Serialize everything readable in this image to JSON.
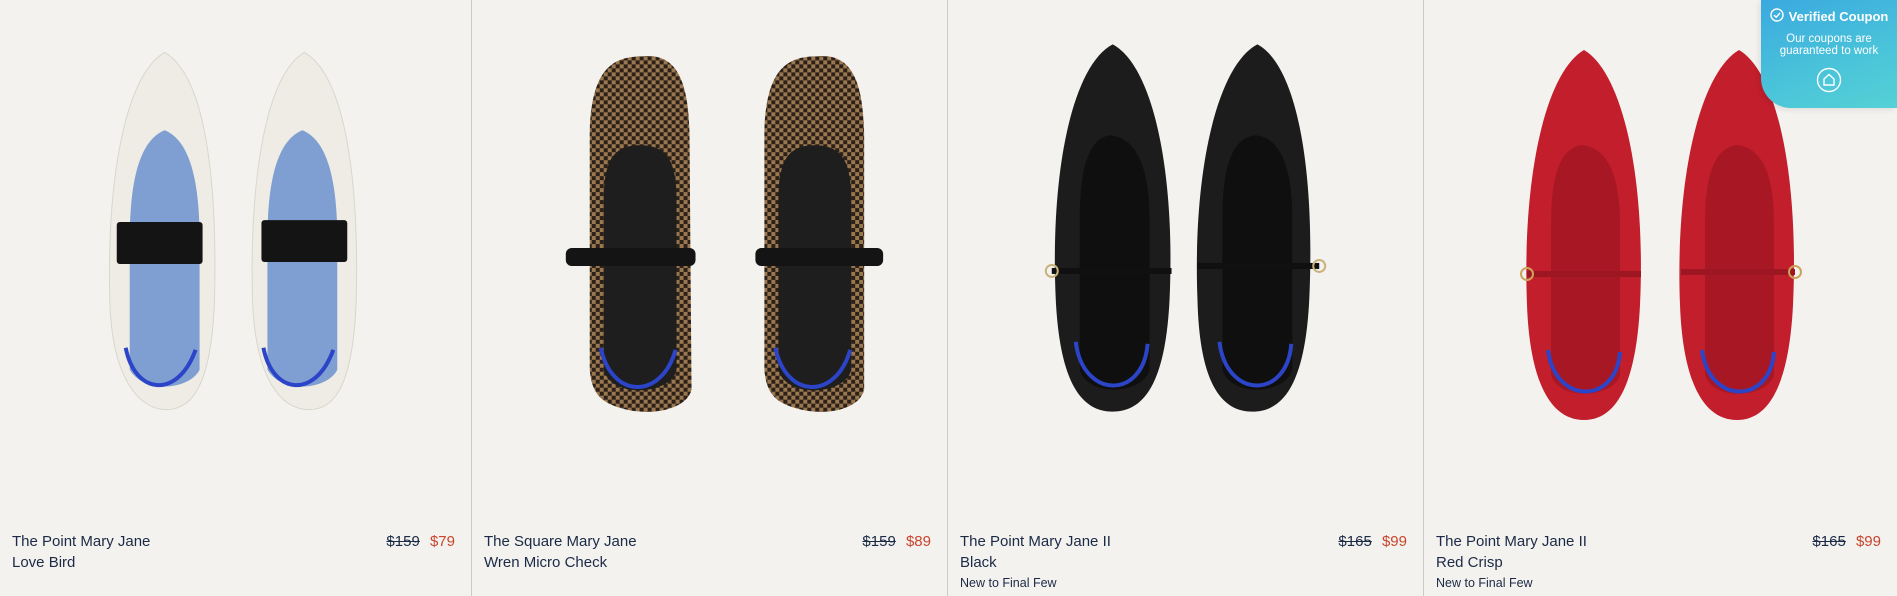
{
  "products": [
    {
      "name": "The Point Mary Jane",
      "variant": "Love Bird",
      "old_price": "$159",
      "price": "$79",
      "tag": ""
    },
    {
      "name": "The Square Mary Jane",
      "variant": "Wren Micro Check",
      "old_price": "$159",
      "price": "$89",
      "tag": ""
    },
    {
      "name": "The Point Mary Jane II",
      "variant": "Black",
      "old_price": "$165",
      "price": "$99",
      "tag": "New to Final Few"
    },
    {
      "name": "The Point Mary Jane II",
      "variant": "Red Crisp",
      "old_price": "$165",
      "price": "$99",
      "tag": "New to Final Few"
    }
  ],
  "coupon": {
    "title": "Verified Coupon",
    "text": "Our coupons are guaranteed to work",
    "icons": {
      "check": "check-circle-icon",
      "home": "home-icon"
    }
  },
  "colors": {
    "background": "#f3f2ef",
    "text": "#1b2a45",
    "sale": "#c8452e",
    "coupon": "#45bde0",
    "insole_blue": "#2c44c7"
  }
}
